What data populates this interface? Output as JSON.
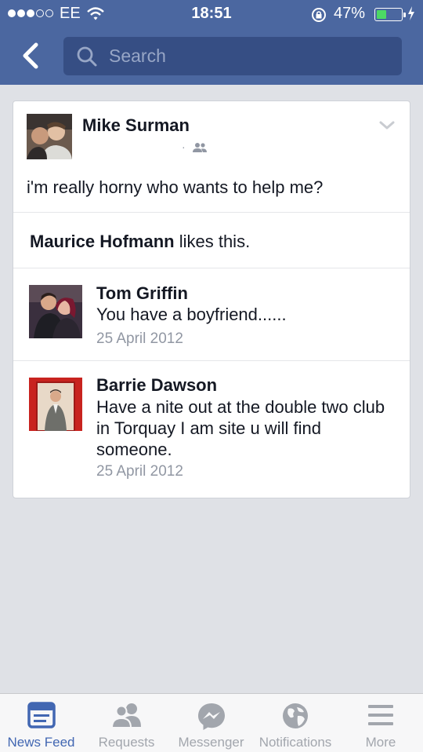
{
  "status_bar": {
    "carrier": "EE",
    "time": "18:51",
    "battery_percent": "47%",
    "battery_level": 0.47
  },
  "search": {
    "placeholder": "Search"
  },
  "post": {
    "author": "Mike Surman",
    "audience_icon": "friends-icon",
    "text": "i'm really horny who wants to help me?",
    "likes": {
      "name": "Maurice Hofmann",
      "suffix": " likes this."
    }
  },
  "comments": [
    {
      "name": "Tom Griffin",
      "text": "You have a boyfriend......",
      "date": "25 April 2012"
    },
    {
      "name": "Barrie Dawson",
      "text": "Have a nite out at the double two club in Torquay I am site u will find someone.",
      "date": "25 April 2012"
    }
  ],
  "tabbar": {
    "tabs": [
      {
        "label": "News Feed",
        "icon": "news-feed-icon",
        "active": true
      },
      {
        "label": "Requests",
        "icon": "requests-icon",
        "active": false
      },
      {
        "label": "Messenger",
        "icon": "messenger-icon",
        "active": false
      },
      {
        "label": "Notifications",
        "icon": "globe-icon",
        "active": false
      },
      {
        "label": "More",
        "icon": "menu-icon",
        "active": false
      }
    ]
  },
  "colors": {
    "header": "#4b67a0",
    "search_box": "#364e84",
    "active_tab": "#4267b2",
    "inactive_tab": "#a2a6ad",
    "battery": "#4cd964",
    "background": "#dfe1e6"
  }
}
